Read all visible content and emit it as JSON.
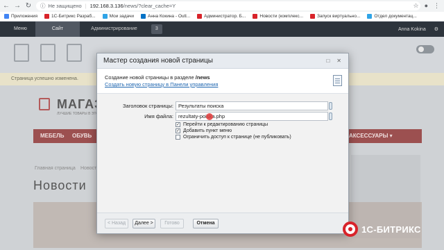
{
  "browser": {
    "security_label": "Не защищено",
    "url_host": "192.168.3.136",
    "url_path": "/news/?clear_cache=Y",
    "bookmarks": [
      {
        "label": "Приложения",
        "color": "#4285f4"
      },
      {
        "label": "1С-Битрикс Разраб...",
        "color": "#d8232a"
      },
      {
        "label": "Мои задачи",
        "color": "#2fa4e7"
      },
      {
        "label": "Анна Кокина - Outl...",
        "color": "#0072c6"
      },
      {
        "label": "Администратор. Б...",
        "color": "#d8232a"
      },
      {
        "label": "Новости (комплекс...",
        "color": "#d8232a"
      },
      {
        "label": "Запуск виртуально...",
        "color": "#d8232a"
      },
      {
        "label": "Отдел документац...",
        "color": "#2fa4e7"
      }
    ]
  },
  "admin_panel": {
    "menu": "Меню",
    "tab_site": "Сайт",
    "tab_admin": "Администрирование",
    "notifications": "3",
    "user": "Anna Kokina"
  },
  "success_text": "Страница успешно изменена.",
  "site": {
    "logo": "МАГАЗ",
    "logo_sub": "ЛУЧШИЕ ТОВАРЫ В ЭТОМ",
    "nav": [
      "МЕБЕЛЬ",
      "ОБУВЬ",
      "АКСЕССУАРЫ ▾"
    ],
    "breadcrumb_main": "Главная страница",
    "breadcrumb_news": "Новости",
    "page_title": "Новости"
  },
  "dialog": {
    "title": "Мастер создания новой страницы",
    "header_line_prefix": "Создание новой страницы в разделе",
    "header_section": "/news",
    "header_link": "Создать новую страницу в Панели управления",
    "title_label": "Заголовок страницы:",
    "title_value": "Результаты поиска",
    "filename_label": "Имя файла:",
    "filename_value": "rezultaty-poiska.php",
    "options": [
      {
        "label": "Перейти к редактированию страницы",
        "checked": true
      },
      {
        "label": "Добавить пункт меню",
        "checked": true
      },
      {
        "label": "Ограничить доступ к странице (не публиковать)",
        "checked": false
      }
    ],
    "buttons": {
      "back": "< Назад",
      "next": "Далее >",
      "done": "Готово",
      "cancel": "Отмена"
    }
  },
  "brand": {
    "text": "1С-БИТРИКС",
    "color": "#d8232a"
  }
}
